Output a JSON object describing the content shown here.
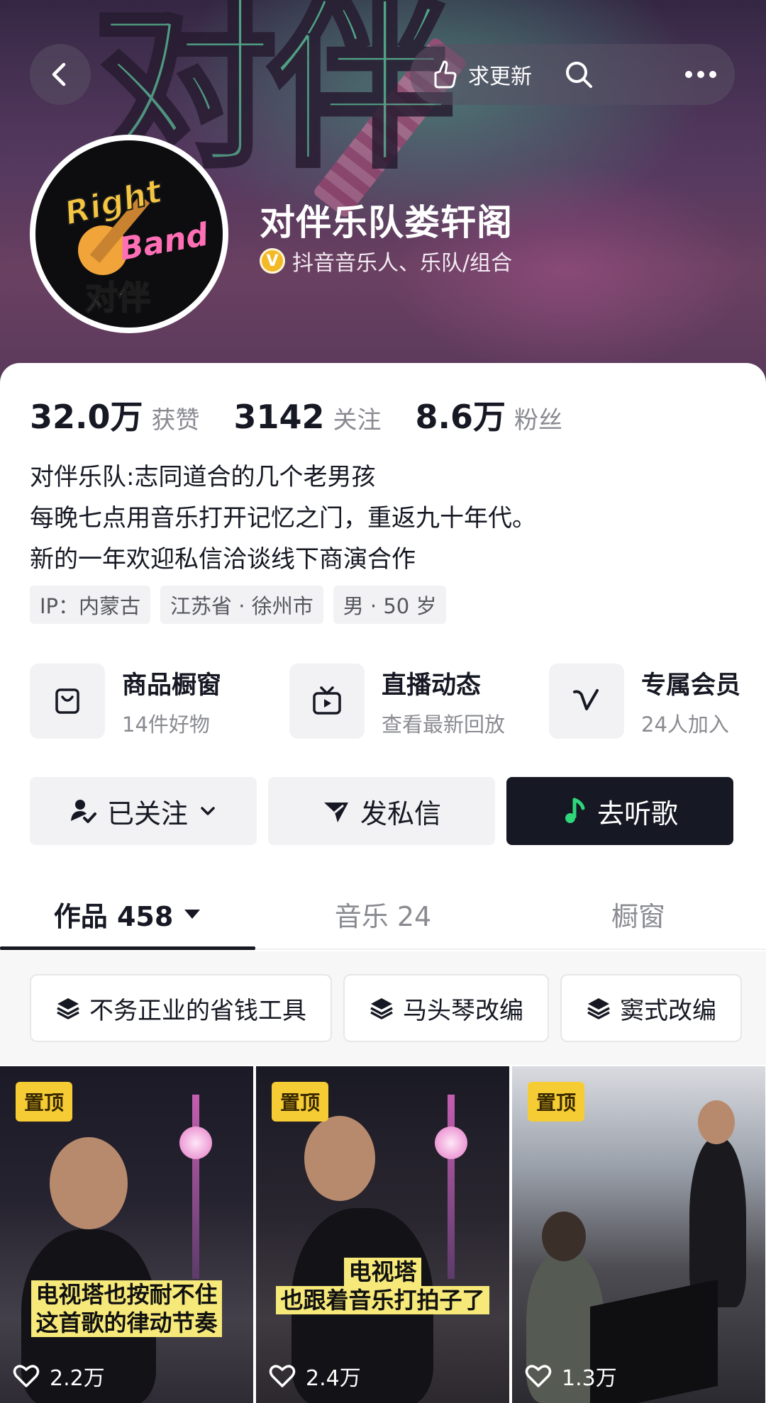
{
  "header": {
    "update_label": "求更新"
  },
  "profile": {
    "name": "对伴乐队娄轩阁",
    "verify_badge": "V",
    "verified_label": "抖音音乐人、乐队/组合",
    "avatar_text_top": "Right",
    "avatar_text_mid": "Band",
    "avatar_text_cn": "对伴"
  },
  "stats": [
    {
      "value": "32.0万",
      "label": "获赞"
    },
    {
      "value": "3142",
      "label": "关注"
    },
    {
      "value": "8.6万",
      "label": "粉丝"
    }
  ],
  "bio": [
    "对伴乐队:志同道合的几个老男孩",
    "每晚七点用音乐打开记忆之门，重返九十年代。",
    "新的一年欢迎私信洽谈线下商演合作"
  ],
  "tags": [
    "IP：内蒙古",
    "江苏省 · 徐州市",
    "男 · 50 岁"
  ],
  "features": [
    {
      "title": "商品橱窗",
      "subtitle": "14件好物"
    },
    {
      "title": "直播动态",
      "subtitle": "查看最新回放"
    },
    {
      "title": "专属会员",
      "subtitle": "24人加入"
    }
  ],
  "actions": {
    "follow": "已关注",
    "message": "发私信",
    "listen": "去听歌"
  },
  "tabs": [
    {
      "label": "作品 458"
    },
    {
      "label": "音乐 24"
    },
    {
      "label": "橱窗"
    }
  ],
  "collections": [
    "不务正业的省钱工具",
    "马头琴改编",
    "窦式改编"
  ],
  "videos": [
    {
      "pin": "置顶",
      "caption_1": "电视塔也按耐不住",
      "caption_2": "这首歌的律动节奏",
      "likes": "2.2万"
    },
    {
      "pin": "置顶",
      "caption_1": "电视塔",
      "caption_2": "也跟着音乐打拍子了",
      "likes": "2.4万"
    },
    {
      "pin": "置顶",
      "caption_1": "",
      "caption_2": "",
      "likes": "1.3万"
    }
  ],
  "colors": {
    "primary_dark": "#161823",
    "listen_icon": "#2fd67a",
    "pin_badge": "#f6cc35",
    "verify_badge": "#f3b927"
  }
}
